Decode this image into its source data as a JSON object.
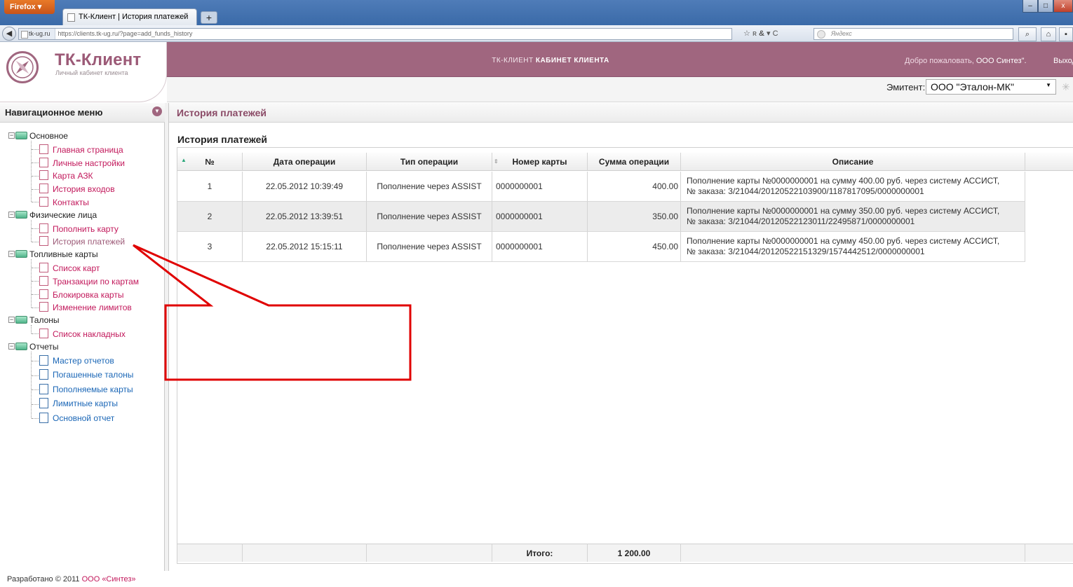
{
  "browser": {
    "menu_label": "Firefox ▾",
    "tab_title": "ТК-Клиент | История платежей",
    "site_identity": "tk-ug.ru",
    "url": "https://clients.tk-ug.ru/?page=add_funds_history",
    "search_placeholder": "Яндекс"
  },
  "header": {
    "brand": "ТК-Клиент",
    "brand_sub": "Личный кабинет клиента",
    "title_prefix": "ТК-КЛИЕНТ",
    "title_main": "КАБИНЕТ КЛИЕНТА",
    "welcome_prefix": "Добро пожаловать,",
    "welcome_user": "ООО Синтез\".",
    "logout": "Выход",
    "emitent_label": "Эмитент:",
    "emitent_value": "ООО \"Эталон-МК\""
  },
  "sidebar": {
    "title": "Навигационное меню",
    "groups": [
      {
        "label": "Основное",
        "items": [
          "Главная страница",
          "Личные настройки",
          "Карта АЗК",
          "История входов",
          "Контакты"
        ]
      },
      {
        "label": "Физические лица",
        "items": [
          "Пополнить карту",
          "История платежей"
        ]
      },
      {
        "label": "Топливные карты",
        "items": [
          "Список карт",
          "Транзакции по картам",
          "Блокировка карты",
          "Изменение лимитов"
        ]
      },
      {
        "label": "Талоны",
        "items": [
          "Список накладных"
        ]
      },
      {
        "label": "Отчеты",
        "items": [
          "Мастер отчетов",
          "Погашенные талоны",
          "Пополняемые карты",
          "Лимитные карты",
          "Основной отчет"
        ]
      }
    ]
  },
  "main": {
    "page_title": "История платежей",
    "grid_title": "История платежей",
    "columns": [
      "№",
      "Дата операции",
      "Тип операции",
      "Номер карты",
      "Сумма операции",
      "Описание"
    ],
    "rows": [
      {
        "n": "1",
        "date": "22.05.2012 10:39:49",
        "type": "Пополнение через ASSIST",
        "card": "0000000001",
        "sum": "400.00",
        "desc1": "Пополнение карты №0000000001 на сумму 400.00 руб. через систему АССИСТ,",
        "desc2": "№ заказа: 3/21044/20120522103900/1187817095/0000000001"
      },
      {
        "n": "2",
        "date": "22.05.2012 13:39:51",
        "type": "Пополнение через ASSIST",
        "card": "0000000001",
        "sum": "350.00",
        "desc1": "Пополнение карты №0000000001 на сумму 350.00 руб. через систему АССИСТ,",
        "desc2": "№ заказа: 3/21044/20120522123011/22495871/0000000001"
      },
      {
        "n": "3",
        "date": "22.05.2012 15:15:11",
        "type": "Пополнение через ASSIST",
        "card": "0000000001",
        "sum": "450.00",
        "desc1": "Пополнение карты №0000000001 на сумму 450.00 руб. через систему АССИСТ,",
        "desc2": "№ заказа: 3/21044/20120522151329/1574442512/0000000001"
      }
    ],
    "footer_label": "Итого:",
    "footer_total": "1 200.00"
  },
  "footer": {
    "prefix": "Разработано © 2011",
    "company": "ООО «Синтез»"
  },
  "colors": {
    "brand": "#a0667f",
    "link": "#c2185b",
    "annotation": "#e00000"
  }
}
